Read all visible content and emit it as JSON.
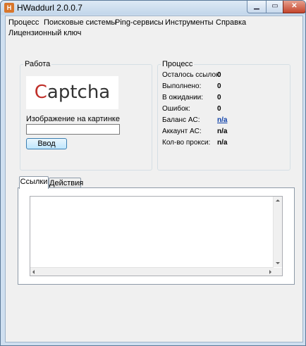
{
  "window": {
    "title": "HWaddurl 2.0.0.7",
    "icon": "app-icon",
    "icon_glyph": "H",
    "minimize_glyph": "▁",
    "maximize_glyph": "▭",
    "close_glyph": "✕"
  },
  "menu": {
    "items": [
      "Процесс",
      "Поисковые системы",
      "Ping-сервисы",
      "Инструменты",
      "Справка",
      "Лицензионный ключ"
    ]
  },
  "work_group": {
    "title": "Работа",
    "captcha_first": "C",
    "captcha_rest": "aptcha",
    "input_label": "Изображение на картинке",
    "input_value": "",
    "submit_label": "Ввод"
  },
  "process_group": {
    "title": "Процесс",
    "stats": [
      {
        "label": "Осталось ссылок:",
        "value": "0"
      },
      {
        "label": "Выполнено:",
        "value": "0"
      },
      {
        "label": "В ожидании:",
        "value": "0"
      },
      {
        "label": "Ошибок:",
        "value": "0"
      },
      {
        "label": "Баланс AC:",
        "value": "n/a"
      },
      {
        "label": "Аккаунт AC:",
        "value": "n/a"
      },
      {
        "label": "Кол-во прокси:",
        "value": "n/a"
      }
    ]
  },
  "tabs": [
    {
      "label": "Ссылки",
      "active": true
    },
    {
      "label": "Действия",
      "active": false
    }
  ],
  "links_text": "",
  "colors": {
    "titlebar": "#c2d6ea",
    "client_bg": "#f0f0f0",
    "link": "#0b3ea8",
    "captcha_accent": "#c0302a",
    "close_button": "#c4452c"
  }
}
